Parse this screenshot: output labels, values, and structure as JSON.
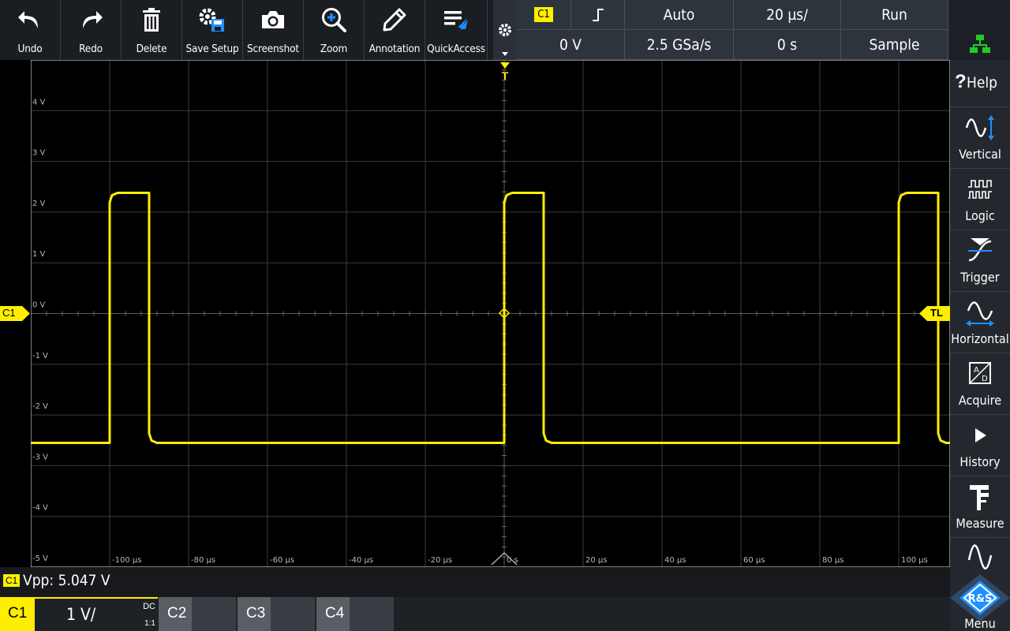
{
  "toolbar": {
    "undo": "Undo",
    "redo": "Redo",
    "delete": "Delete",
    "save_setup": "Save Setup",
    "screenshot": "Screenshot",
    "zoom": "Zoom",
    "annotation": "Annotation",
    "quickaccess": "QuickAccess"
  },
  "info": {
    "trigger_source": "C1",
    "trigger_level": "0 V",
    "trigger_mode": "Auto",
    "sample_rate": "2.5 GSa/s",
    "time_scale": "20 µs/",
    "time_offset": "0 s",
    "run_state": "Run",
    "acquire_mode": "Sample"
  },
  "markers": {
    "trigger_pos": "T",
    "channel": "C1",
    "trigger_level": "TL"
  },
  "axis": {
    "v_labels": [
      "4 V",
      "3 V",
      "2 V",
      "1 V",
      "0 V",
      "-1 V",
      "-2 V",
      "-3 V",
      "-4 V",
      "-5 V"
    ],
    "t_labels": [
      "-100 µs",
      "-80 µs",
      "-60 µs",
      "-40 µs",
      "-20 µs",
      "0 s",
      "20 µs",
      "40 µs",
      "60 µs",
      "80 µs",
      "100 µs"
    ]
  },
  "sidebar": {
    "help": "Help",
    "vertical": "Vertical",
    "logic": "Logic",
    "trigger": "Trigger",
    "horizontal": "Horizontal",
    "acquire": "Acquire",
    "history": "History",
    "measure": "Measure",
    "menu": "Menu",
    "logo_text": "R&S"
  },
  "measurement": {
    "channel": "C1",
    "text": "Vpp: 5.047 V"
  },
  "channels": {
    "c1_label": "C1",
    "c1_scale": "1 V/",
    "c1_coupling": "DC",
    "c1_probe": "1:1",
    "c2_label": "C2",
    "c3_label": "C3",
    "c4_label": "C4"
  },
  "colors": {
    "trace": "#ffee00",
    "grid": "#3c3c3c",
    "accent_blue": "#1e90ff",
    "network_green": "#22cc22"
  },
  "waveform": {
    "channel": "C1",
    "high_level_v": 2.38,
    "low_level_v": -2.55,
    "period_us": 100,
    "high_duration_us": 10,
    "rising_edges_us": [
      -100,
      0,
      100
    ],
    "timebase_us_per_div": 20,
    "volts_per_div": 1
  }
}
